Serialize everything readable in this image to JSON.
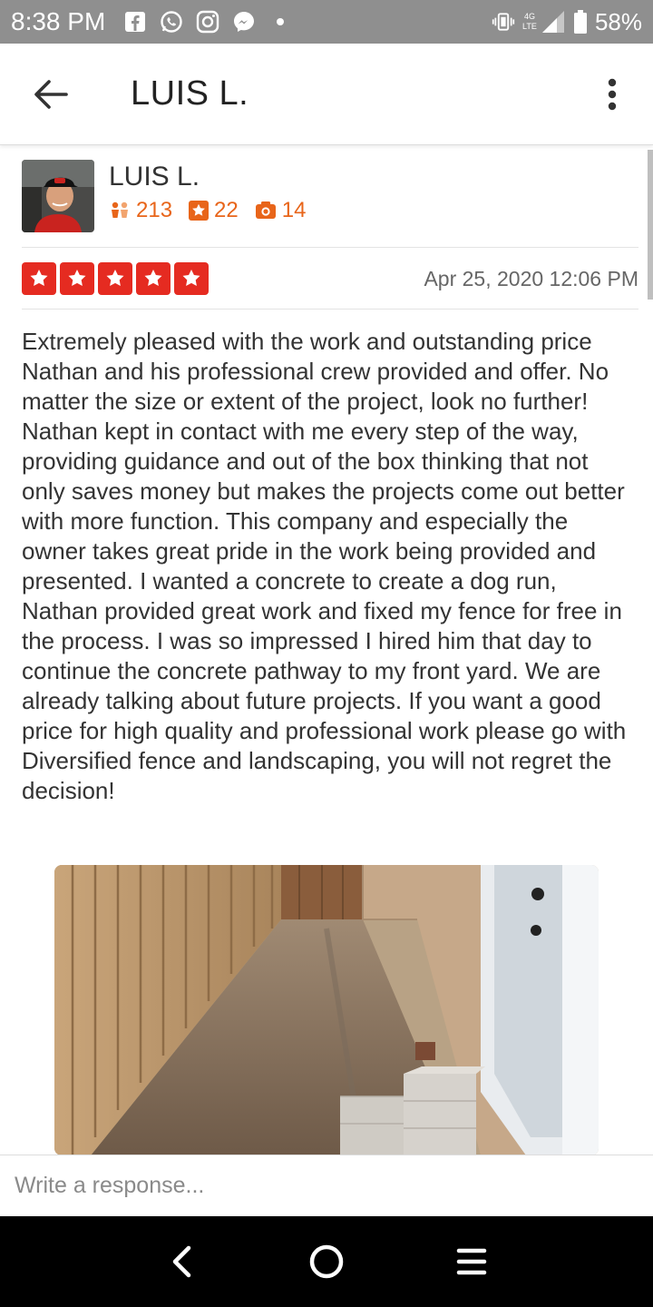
{
  "status_bar": {
    "time": "8:38 PM",
    "network": "4G LTE",
    "battery": "58%",
    "icons": [
      "facebook-icon",
      "whatsapp-icon",
      "instagram-icon",
      "messenger-icon",
      "dot-icon",
      "vibrate-icon",
      "signal-icon",
      "battery-icon"
    ]
  },
  "app_bar": {
    "title": "LUIS L."
  },
  "reviewer": {
    "name": "LUIS L.",
    "friends": "213",
    "reviews": "22",
    "photos": "14"
  },
  "review": {
    "rating": 5,
    "date": "Apr 25, 2020 12:06 PM",
    "text": "Extremely pleased with the work and outstanding price Nathan and his professional crew provided and offer. No matter the size or extent of the project, look no further! Nathan kept in contact with me every step of the way, providing guidance and out of the box thinking that not only saves money but makes the projects come out better with more function. This company and especially the owner takes great pride in the work being provided and presented. I wanted a concrete to create a dog run, Nathan provided great work and fixed my fence for free in the process. I was so impressed I hired him that day to continue the concrete pathway to my front yard. We are already talking about future projects. If you want a good price for high quality and professional work please go with Diversified fence and landscaping, you will not regret the decision!"
  },
  "response": {
    "placeholder": "Write a response..."
  },
  "colors": {
    "star_red": "#e52b21",
    "stat_orange": "#e8651a",
    "status_gray": "#8f8f8f"
  }
}
